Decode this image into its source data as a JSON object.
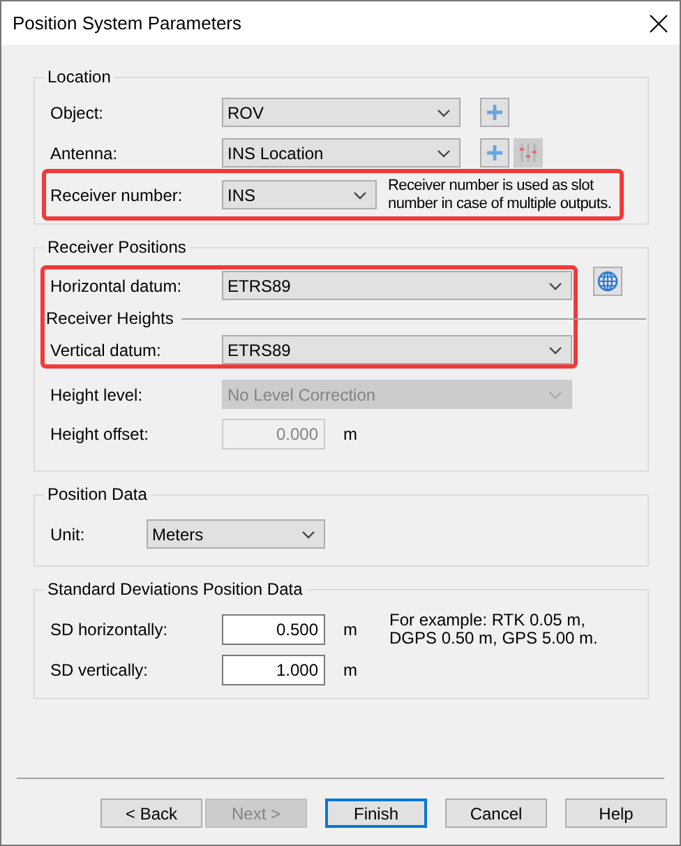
{
  "window": {
    "title": "Position System Parameters"
  },
  "location": {
    "legend": "Location",
    "rows": [
      {
        "label": "Object:",
        "value": "ROV",
        "highlighted": false,
        "tools": [
          {
            "kind": "add",
            "disabled": false
          }
        ]
      },
      {
        "label": "Antenna:",
        "value": "INS Location",
        "highlighted": false,
        "tools": [
          {
            "kind": "add",
            "disabled": false
          },
          {
            "kind": "adjust",
            "disabled": true
          }
        ]
      },
      {
        "label": "Receiver number:",
        "value": "INS",
        "highlighted": true,
        "note": "Receiver number is used as slot\nnumber in case of multiple outputs."
      }
    ]
  },
  "receiver_positions": {
    "legend": "Receiver Positions",
    "datum_block": {
      "highlighted": true,
      "horizontal": {
        "label": "Horizontal datum:",
        "value": "ETRS89"
      },
      "heights_legend": "Receiver Heights",
      "vertical": {
        "label": "Vertical datum:",
        "value": "ETRS89"
      }
    },
    "globe_tool": {
      "kind": "globe",
      "disabled": false
    },
    "height_level": {
      "label": "Height level:",
      "value": "No Level Correction",
      "disabled": true
    },
    "height_offset": {
      "label": "Height offset:",
      "value": "0.000",
      "unit": "m",
      "disabled": true
    }
  },
  "position_data": {
    "legend": "Position Data",
    "unit": {
      "label": "Unit:",
      "value": "Meters"
    }
  },
  "standard_deviations": {
    "legend": "Standard Deviations Position Data",
    "rows": [
      {
        "label": "SD horizontally:",
        "value": "0.500",
        "unit": "m"
      },
      {
        "label": "SD vertically:",
        "value": "1.000",
        "unit": "m"
      }
    ],
    "note": "For example: RTK 0.05 m,\nDGPS 0.50 m, GPS 5.00 m."
  },
  "buttons": [
    {
      "label": "< Back",
      "disabled": false,
      "default": false
    },
    {
      "label": "Next >",
      "disabled": true,
      "default": false
    },
    {
      "label": "Finish",
      "disabled": false,
      "default": true
    },
    {
      "label": "Cancel",
      "disabled": false,
      "default": false
    },
    {
      "label": "Help",
      "disabled": false,
      "default": false
    }
  ]
}
